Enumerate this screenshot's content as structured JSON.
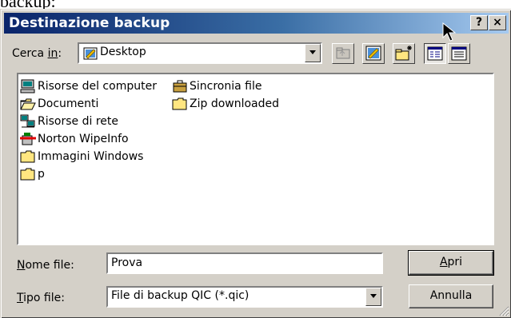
{
  "window": {
    "caption_above": "backup:",
    "title": "Destinazione backup",
    "help_label": "?",
    "close_label": "×"
  },
  "lookin": {
    "label_prefix": "Cerca ",
    "label_underlined": "in",
    "label_suffix": ":",
    "value": "Desktop"
  },
  "toolbar": {
    "buttons": [
      "up-one-level",
      "go-to-desktop",
      "create-new-folder",
      "list-view",
      "details-view"
    ],
    "active": "list-view"
  },
  "files": {
    "items": [
      {
        "label": "Risorse del computer",
        "icon": "my-computer-icon"
      },
      {
        "label": "Documenti",
        "icon": "open-folder-icon"
      },
      {
        "label": "Risorse di rete",
        "icon": "network-icon"
      },
      {
        "label": "Norton WipeInfo",
        "icon": "norton-wipeinfo-icon"
      },
      {
        "label": "Immagini Windows",
        "icon": "folder-icon"
      },
      {
        "label": "p",
        "icon": "folder-icon"
      },
      {
        "label": "Sincronia file",
        "icon": "briefcase-icon"
      },
      {
        "label": "Zip downloaded",
        "icon": "folder-icon"
      }
    ]
  },
  "filename": {
    "label_underlined": "N",
    "label_rest": "ome file:",
    "value": "Prova"
  },
  "filetype": {
    "label_underlined": "T",
    "label_rest": "ipo file:",
    "value": "File di backup QIC (*.qic)"
  },
  "buttons": {
    "open_underlined": "A",
    "open_rest": "pri",
    "cancel": "Annulla"
  },
  "colors": {
    "title_start": "#0a246a",
    "title_end": "#a6caf0",
    "face": "#d4d0c8"
  }
}
